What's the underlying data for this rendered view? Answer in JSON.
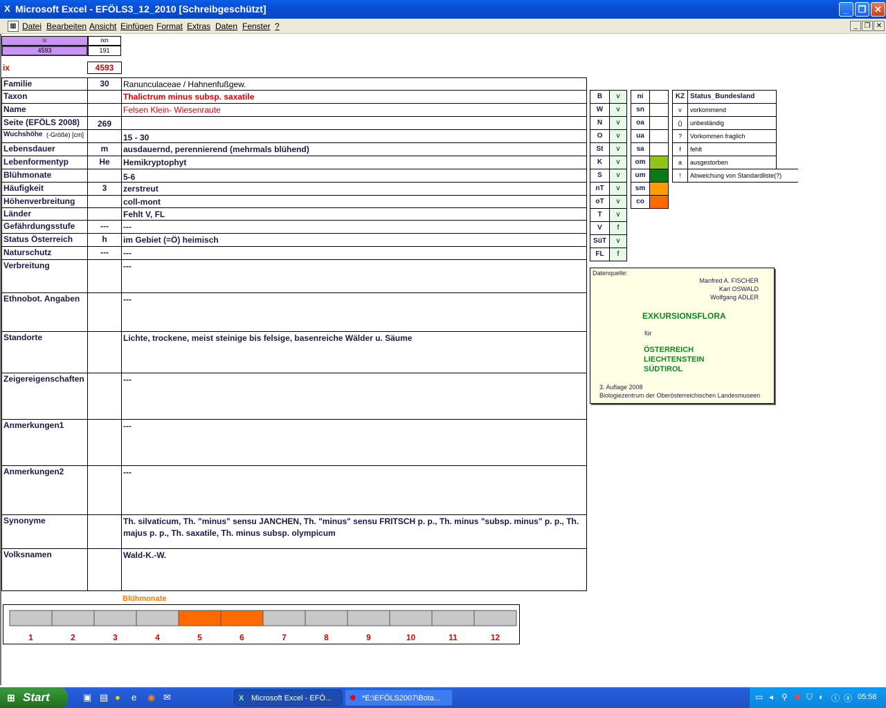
{
  "window": {
    "title": "Microsoft Excel - EFÖLS3_12_2010  [Schreibgeschützt]"
  },
  "menu": [
    "Datei",
    "Bearbeiten",
    "Ansicht",
    "Einfügen",
    "Format",
    "Extras",
    "Daten",
    "Fenster",
    "?"
  ],
  "top": {
    "ix_header": "ix",
    "ixn_header": "ixn",
    "ix_value": "4593",
    "ixn_value": "191",
    "ix_label": "ix",
    "ix_big": "4593"
  },
  "rows": [
    {
      "label": "Familie",
      "code": "30",
      "value": "Ranunculaceae  /  Hahnenfußgew."
    },
    {
      "label": "Taxon",
      "code": "",
      "value": "Thalictrum minus subsp. saxatile"
    },
    {
      "label": "Name",
      "code": "",
      "value": "Felsen Klein- Wiesenraute"
    },
    {
      "label": "Seite (EFÖLS 2008)",
      "code": "269",
      "value": ""
    },
    {
      "label": "Wuchshöhe",
      "label2": " (-Größe) [cm]",
      "code": "",
      "value": " 15 - 30"
    },
    {
      "label": "Lebensdauer",
      "code": "m",
      "value": "ausdauernd, perennierend (mehrmals blühend)"
    },
    {
      "label": "Lebenformentyp",
      "code": "He",
      "value": "Hemikryptophyt"
    },
    {
      "label": "Blühmonate",
      "code": "",
      "value": " 5-6"
    },
    {
      "label": "Häufigkeit",
      "code": "3",
      "value": "zerstreut"
    },
    {
      "label": "Höhenverbreitung",
      "code": "",
      "value": "coll-mont"
    },
    {
      "label": "Länder",
      "code": "",
      "value": "Fehlt V, FL"
    },
    {
      "label": "Gefährdungsstufe",
      "code": "---",
      "value": "  ---"
    },
    {
      "label": "Status Österreich",
      "code": "h",
      "value": "im Gebiet (=Ö) heimisch"
    },
    {
      "label": "Naturschutz",
      "code": "---",
      "value": " ---"
    },
    {
      "label": "Verbreitung",
      "code": "",
      "value": " ---"
    },
    {
      "label": "Ethnobot. Angaben",
      "code": "",
      "value": "---"
    },
    {
      "label": "Standorte",
      "code": "",
      "value": " Lichte, trockene, meist steinige bis felsige, basenreiche Wälder u. Säume"
    },
    {
      "label": "Zeigereigenschaften",
      "code": "",
      "value": "---"
    },
    {
      "label": "Anmerkungen1",
      "code": "",
      "value": "---"
    },
    {
      "label": "Anmerkungen2",
      "code": "",
      "value": "---"
    },
    {
      "label": "Synonyme",
      "code": "",
      "value": "Th. silvaticum, Th. \"minus\" sensu JANCHEN, Th. \"minus\" sensu FRITSCH p. p., Th. minus \"subsp. minus\" p. p., Th. majus p. p., Th. saxatile, Th. minus subsp. olympicum"
    },
    {
      "label": "Volksnamen",
      "code": "",
      "value": "Wald-K.-W."
    }
  ],
  "laender": [
    {
      "code": "B",
      "val": "v"
    },
    {
      "code": "W",
      "val": "v"
    },
    {
      "code": "N",
      "val": "v"
    },
    {
      "code": "O",
      "val": "v"
    },
    {
      "code": "St",
      "val": "v"
    },
    {
      "code": "K",
      "val": "v"
    },
    {
      "code": "S",
      "val": "v"
    },
    {
      "code": "nT",
      "val": "v"
    },
    {
      "code": "oT",
      "val": "v"
    },
    {
      "code": "T",
      "val": "v"
    },
    {
      "code": "V",
      "val": "f"
    },
    {
      "code": "SüT",
      "val": "v"
    },
    {
      "code": "FL",
      "val": "f"
    }
  ],
  "hoehen": [
    {
      "code": "ni",
      "val": ""
    },
    {
      "code": "sn",
      "val": ""
    },
    {
      "code": "oa",
      "val": ""
    },
    {
      "code": "ua",
      "val": ""
    },
    {
      "code": "sa",
      "val": ""
    },
    {
      "code": "om",
      "val": "",
      "color": "#8fc418"
    },
    {
      "code": "um",
      "val": "",
      "color": "#0a7a14"
    },
    {
      "code": "sm",
      "val": "",
      "color": "#ff9c00"
    },
    {
      "code": "co",
      "val": "",
      "color": "#ff6a00"
    }
  ],
  "status_legend": {
    "header_kz": "KZ",
    "header_status": "Status_Bundesland",
    "items": [
      {
        "kz": "v",
        "text": "vorkommend"
      },
      {
        "kz": "()",
        "text": "unbeständig"
      },
      {
        "kz": "?",
        "text": "Vorkommen fraglich"
      },
      {
        "kz": "f",
        "text": "fehlt"
      },
      {
        "kz": "a",
        "text": "ausgestorben"
      },
      {
        "kz": "!",
        "text": "Abweichung von Standardliste(?)"
      }
    ]
  },
  "source": {
    "label": "Datenquelle:",
    "authors": [
      "Manfred A. FISCHER",
      "Karl OSWALD",
      "Wolfgang ADLER"
    ],
    "title": "EXKURSIONSFLORA",
    "fuer": "für",
    "countries": [
      "ÖSTERREICH",
      "LIECHTENSTEIN",
      "SÜDTIROL"
    ],
    "edition": "3. Auflage 2008",
    "publisher": "Biologiezentrum der Oberösterreichischen Landesmuseen"
  },
  "chart_data": {
    "type": "bar",
    "title": "Blühmonate",
    "categories": [
      "1",
      "2",
      "3",
      "4",
      "5",
      "6",
      "7",
      "8",
      "9",
      "10",
      "11",
      "12"
    ],
    "values": [
      0,
      0,
      0,
      0,
      1,
      1,
      0,
      0,
      0,
      0,
      0,
      0
    ],
    "colors": {
      "active": "#ff6a00",
      "inactive": "#c8c8c8"
    }
  },
  "taskbar": {
    "start": "Start",
    "buttons": [
      "Microsoft Excel - EFÖ...",
      "*E:\\EFÖLS2007\\Bota..."
    ],
    "clock": "05:58"
  }
}
